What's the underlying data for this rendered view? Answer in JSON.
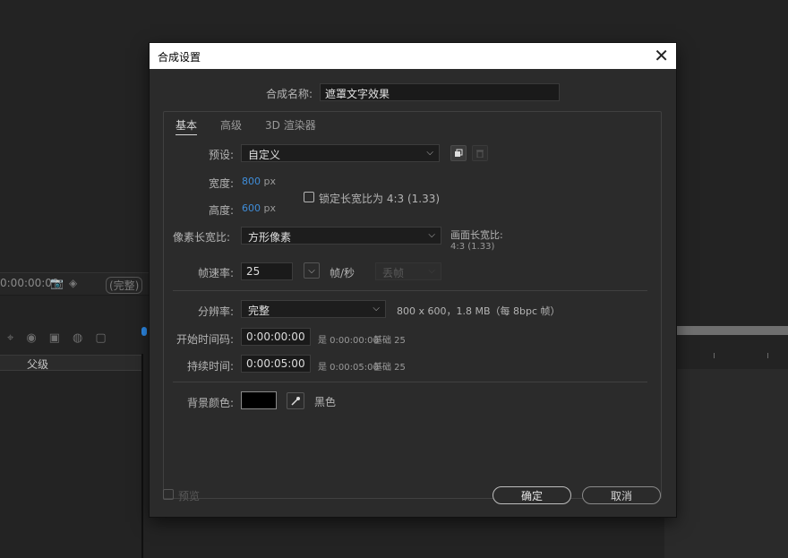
{
  "background": {
    "timecode": "0:00:00:00",
    "quality": "(完整)",
    "header_label": "父级"
  },
  "dialog": {
    "title": "合成设置",
    "close_glyph": "✕",
    "name_label": "合成名称:",
    "name_value": "遮罩文字效果",
    "tabs": [
      "基本",
      "高级",
      "3D 渲染器"
    ],
    "preset": {
      "label": "预设:",
      "value": "自定义"
    },
    "width": {
      "label": "宽度:",
      "value": "800",
      "unit": "px"
    },
    "height": {
      "label": "高度:",
      "value": "600",
      "unit": "px"
    },
    "lock_ratio": {
      "label": "锁定长宽比为 4:3 (1.33)",
      "checked": false
    },
    "pixel_aspect": {
      "label": "像素长宽比:",
      "value": "方形像素"
    },
    "frame_aspect": {
      "label": "画面长宽比:",
      "value": "4:3 (1.33)"
    },
    "frame_rate": {
      "label": "帧速率:",
      "value": "25",
      "unit": "帧/秒",
      "drop_frame": "丢帧"
    },
    "resolution": {
      "label": "分辨率:",
      "value": "完整",
      "info": "800 x 600，1.8 MB（每 8bpc 帧）"
    },
    "start_timecode": {
      "label": "开始时间码:",
      "value": "0:00:00:00",
      "info_is": "是 0:00:00:00",
      "info_base": "基础 25"
    },
    "duration": {
      "label": "持续时间:",
      "value": "0:00:05:00",
      "info_is": "是 0:00:05:00",
      "info_base": "基础 25"
    },
    "bg_color": {
      "label": "背景颜色:",
      "name": "黑色",
      "color": "#000000"
    },
    "preview": {
      "label": "预览",
      "checked": false
    },
    "ok_label": "确定",
    "cancel_label": "取消"
  }
}
